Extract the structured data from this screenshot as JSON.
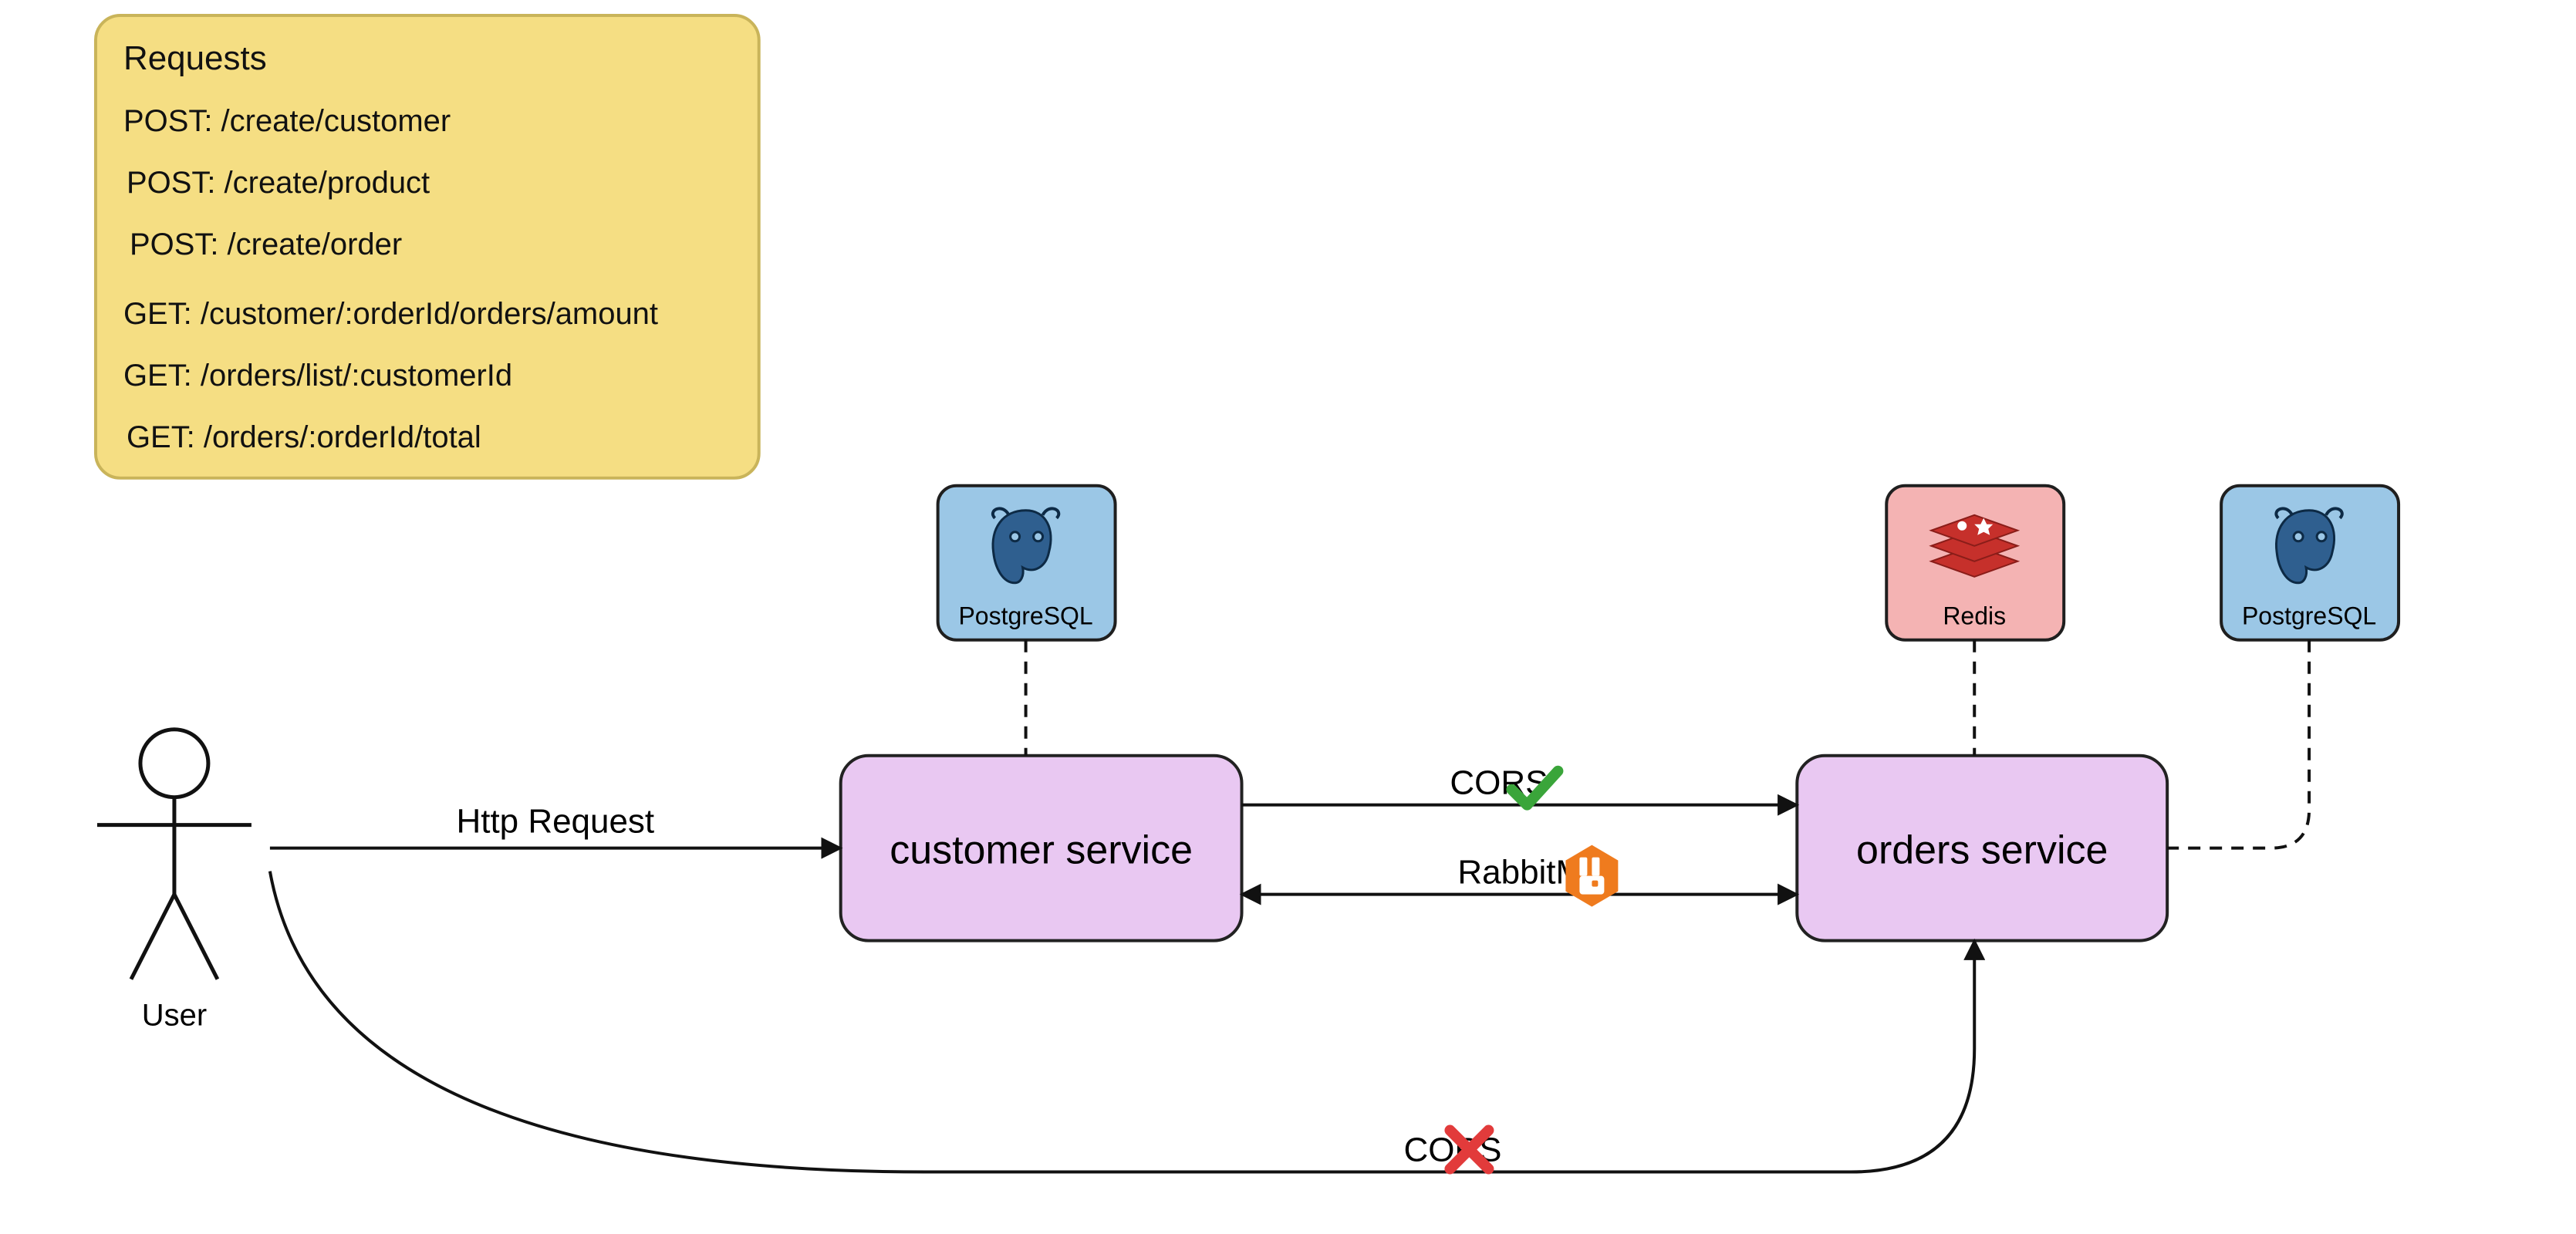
{
  "note": {
    "title": "Requests",
    "lines": [
      "POST: /create/customer",
      "POST: /create/product",
      "POST: /create/order",
      "GET: /customer/:orderId/orders/amount",
      "GET: /orders/list/:customerId",
      "GET: /orders/:orderId/total"
    ]
  },
  "actor": {
    "label": "User"
  },
  "services": {
    "customer": "customer service",
    "orders": "orders service"
  },
  "dbs": {
    "postgres1": "PostgreSQL",
    "redis": "Redis",
    "postgres2": "PostgreSQL"
  },
  "edges": {
    "httpRequest": "Http Request",
    "corsOk": "CORS",
    "rabbit": "RabbitMQ",
    "corsFail": "CORS"
  },
  "colors": {
    "noteFill": "#f5de83",
    "noteStroke": "#c9b45a",
    "serviceFill": "#e9c8f2",
    "serviceStroke": "#222222",
    "postgresFill": "#9bc7e6",
    "postgresStroke": "#1f1f1f",
    "redisFill": "#f4b3b3",
    "redisStroke": "#1f1f1f",
    "check": "#3aa53a",
    "cross": "#e23b3b",
    "rabbitIcon": "#ef7b1e"
  }
}
